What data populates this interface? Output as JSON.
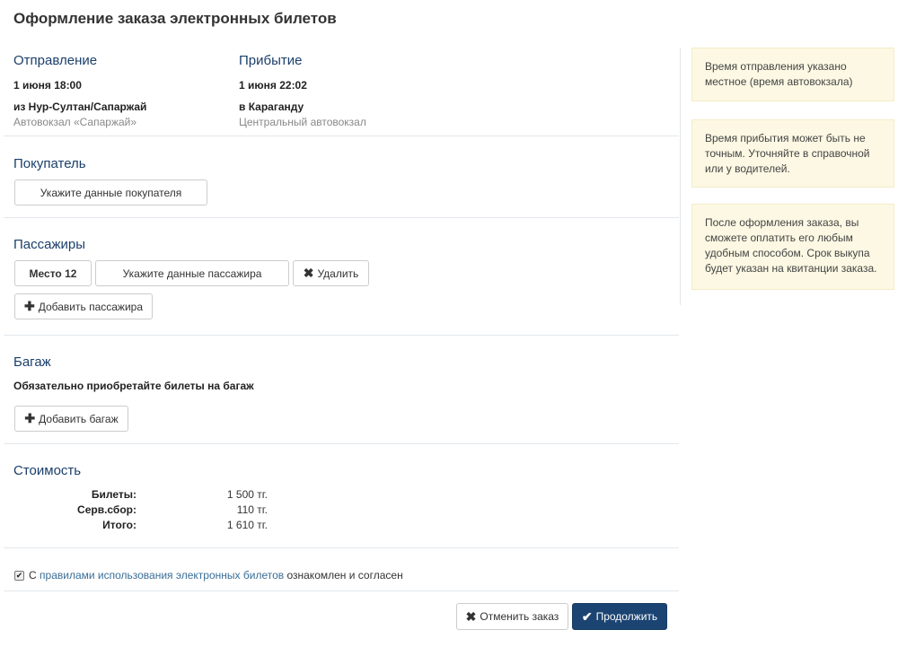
{
  "page_title": "Оформление заказа электронных билетов",
  "route": {
    "departure": {
      "title": "Отправление",
      "datetime": "1 июня 18:00",
      "city": "из Нур-Султан/Сапаржай",
      "station": "Автовокзал «Сапаржай»"
    },
    "arrival": {
      "title": "Прибытие",
      "datetime": "1 июня 22:02",
      "city": "в Караганду",
      "station": "Центральный автовокзал"
    }
  },
  "buyer": {
    "title": "Покупатель",
    "button_label": "Укажите данные покупателя"
  },
  "passengers": {
    "title": "Пассажиры",
    "seat_label": "Место 12",
    "data_button_label": "Укажите данные пассажира",
    "delete_label": "Удалить",
    "add_label": "Добавить пассажира"
  },
  "baggage": {
    "title": "Багаж",
    "note": "Обязательно приобретайте билеты на багаж",
    "add_label": "Добавить багаж"
  },
  "cost": {
    "title": "Стоимость",
    "rows": [
      {
        "label": "Билеты:",
        "value": "1 500 тг."
      },
      {
        "label": "Серв.сбор:",
        "value": "110 тг."
      },
      {
        "label": "Итого:",
        "value": "1 610 тг."
      }
    ]
  },
  "agreement": {
    "checked": true,
    "prefix": "С",
    "link_text": "правилами использования электронных билетов",
    "suffix": "ознакомлен и согласен"
  },
  "actions": {
    "cancel_label": "Отменить заказ",
    "continue_label": "Продолжить"
  },
  "tips": [
    "Время отправления указано местное (время автовокзала)",
    "Время прибытия может быть не точным. Уточняйте в справочной или у водителей.",
    "После оформления заказа, вы сможете оплатить его любым удобным способом. Срок выкупа будет указан на квитанции заказа."
  ],
  "colors": {
    "section_title": "#1b3f6b",
    "primary_button": "#1b4472",
    "tip_background": "#fcf8e3",
    "link": "#3a6e96"
  }
}
